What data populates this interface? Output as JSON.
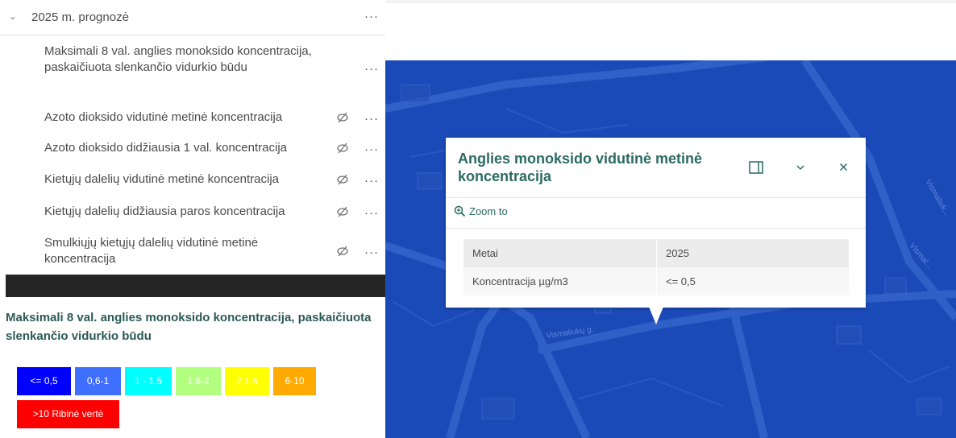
{
  "layer_list": {
    "group_title": "2025 m. prognozė",
    "items": [
      {
        "label": "Maksimali 8 val. anglies monoksido koncentracija, paskaičiuota slenkančio vidurkio būdu",
        "hidden": false
      },
      {
        "label": "Azoto dioksido vidutinė metinė koncentracija",
        "hidden": true
      },
      {
        "label": "Azoto dioksido didžiausia 1 val. koncentracija",
        "hidden": true
      },
      {
        "label": "Kietųjų dalelių vidutinė metinė koncentracija",
        "hidden": true
      },
      {
        "label": "Kietųjų dalelių didžiausia paros koncentracija",
        "hidden": true
      },
      {
        "label": "Smulkiųjų kietųjų dalelių vidutinė metinė koncentracija",
        "hidden": true
      }
    ],
    "more_icon": "ellipsis-icon",
    "hidden_icon": "eye-slash-icon"
  },
  "legend": {
    "title": "Maksimali 8 val. anglies monoksido koncentracija, paskaičiuota slenkančio vidurkio būdu",
    "classes": [
      {
        "label": "<= 0,5",
        "color": "#0000ff",
        "text_color": "#ffffff"
      },
      {
        "label": "0,6-1",
        "color": "#3f6fff",
        "text_color": "#ffffff"
      },
      {
        "label": "1 - 1,5",
        "color": "#00ffff",
        "text_color": "#ffffff"
      },
      {
        "label": "1,6-2",
        "color": "#b2ff7f",
        "text_color": "#ffffff"
      },
      {
        "label": "2,1-5",
        "color": "#ffff00",
        "text_color": "#ffffff"
      },
      {
        "label": "6-10",
        "color": "#ffaa00",
        "text_color": "#ffffff"
      },
      {
        "label": ">10 Ribinė vertė",
        "color": "#ff0000",
        "text_color": "#ffffff"
      }
    ]
  },
  "map": {
    "background": "#1a4ab8",
    "street_labels": [
      "Vismaliukų g.",
      "Vismaliuk...",
      "Vismal..."
    ]
  },
  "popup": {
    "title": "Anglies monoksido vidutinė metinė koncentracija",
    "zoom_label": "Zoom to",
    "accent": "#2b6a62",
    "rows": [
      {
        "field": "Metai",
        "value": "2025"
      },
      {
        "field": "Koncentracija µg/m3",
        "value": "<= 0,5"
      }
    ]
  }
}
